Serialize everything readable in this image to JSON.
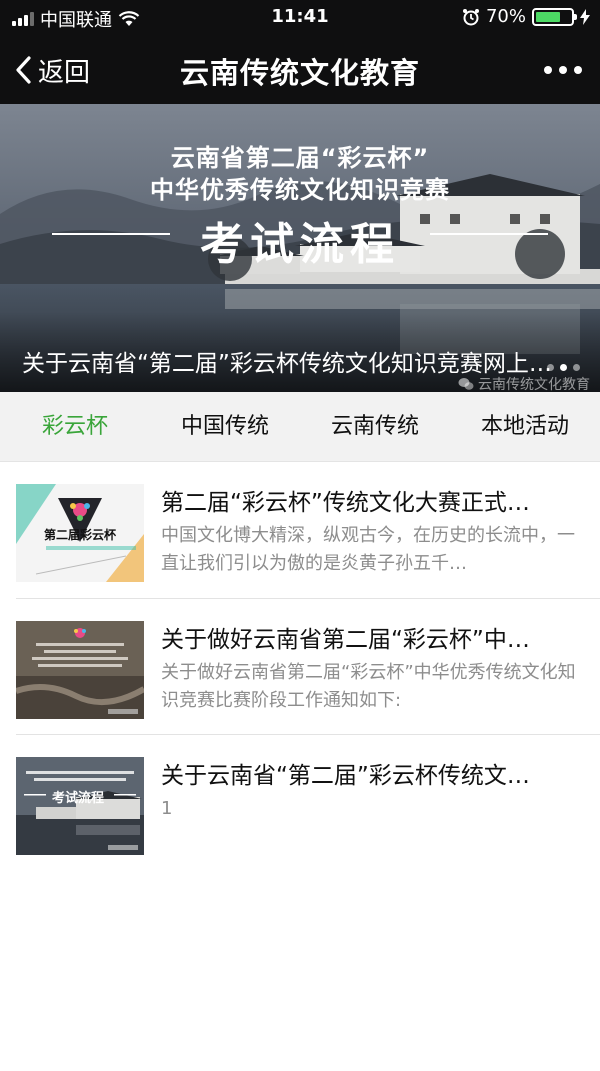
{
  "status_bar": {
    "carrier": "中国联通",
    "time": "11:41",
    "battery_percent": "70%",
    "battery_level": 0.7
  },
  "nav": {
    "back_label": "返回",
    "title": "云南传统文化教育"
  },
  "banner": {
    "line1": "云南省第二届“彩云杯”",
    "line2": "中华优秀传统文化知识竞赛",
    "big_text": "考试流程",
    "caption": "关于云南省“第二届”彩云杯传统文化知识竞赛网上…",
    "watermark": "云南传统文化教育",
    "slide_count": 3,
    "active_slide": 2
  },
  "tabs": [
    {
      "label": "彩云杯",
      "active": true
    },
    {
      "label": "中国传统",
      "active": false
    },
    {
      "label": "云南传统",
      "active": false
    },
    {
      "label": "本地活动",
      "active": false
    }
  ],
  "articles": [
    {
      "title": "第二届“彩云杯”传统文化大赛正式…",
      "desc": "中国文化博大精深，纵观古今，在历史的长流中，一直让我们引以为傲的是炎黄子孙五千…",
      "thumb_text": "第二届彩云杯"
    },
    {
      "title": "关于做好云南省第二届“彩云杯”中…",
      "desc": "关于做好云南省第二届“彩云杯”中华优秀传统文化知识竞赛比赛阶段工作通知如下:",
      "thumb_text": ""
    },
    {
      "title": "关于云南省“第二届”彩云杯传统文…",
      "desc": "1",
      "thumb_text": "考试流程"
    }
  ],
  "colors": {
    "accent": "#3aa53a",
    "bar_bg": "#0f0f10",
    "battery": "#4cd964"
  }
}
